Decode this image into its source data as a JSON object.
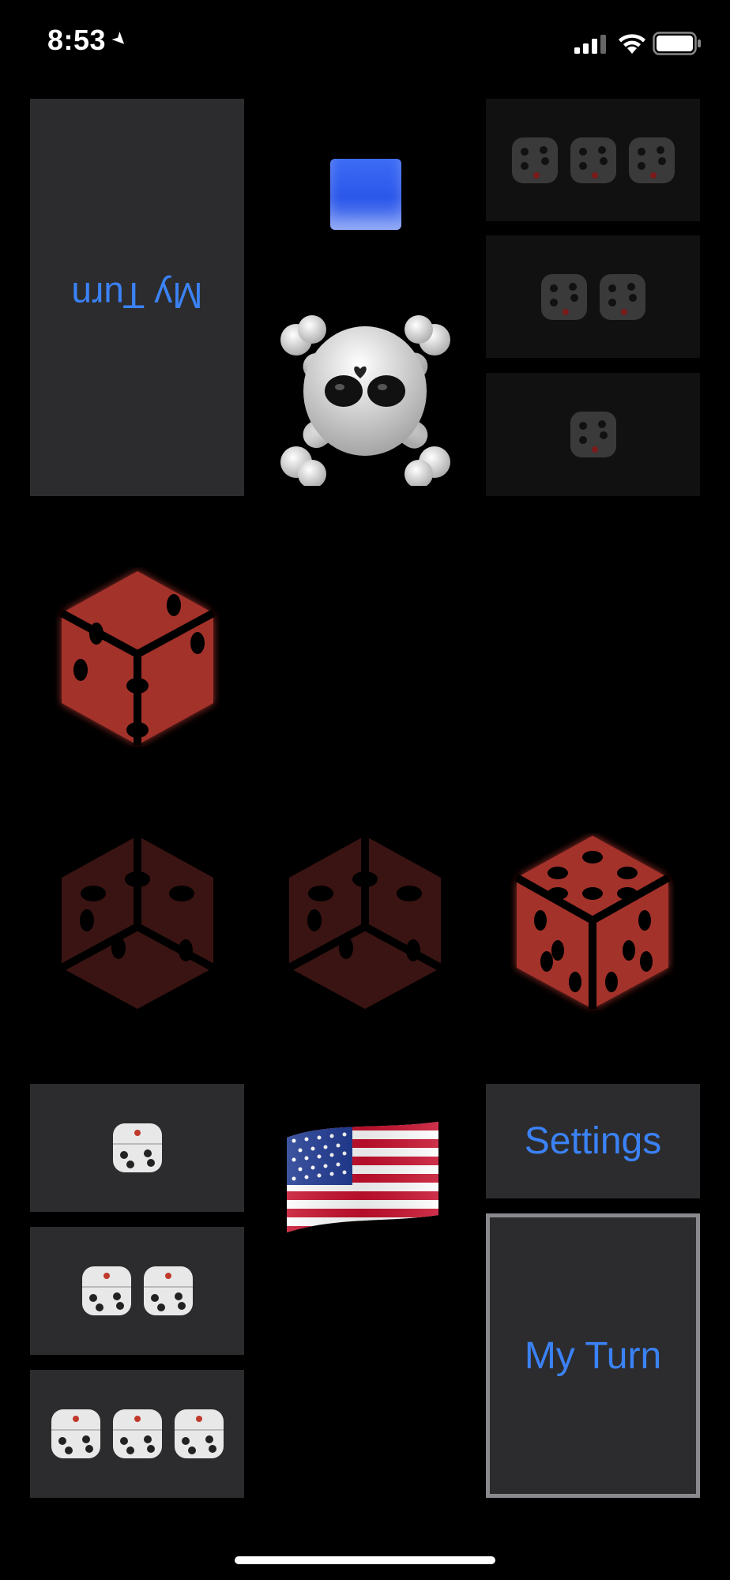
{
  "status_bar": {
    "time": "8:53",
    "location_icon": "location-arrow-icon",
    "signal_icon": "cellular-signal-icon",
    "wifi_icon": "wifi-icon",
    "battery_icon": "battery-icon"
  },
  "top_player": {
    "my_turn_label": "My Turn",
    "rotated": true,
    "bet_options": [
      {
        "dice_count": 3
      },
      {
        "dice_count": 2
      },
      {
        "dice_count": 1
      }
    ],
    "color_indicator": "#2f5ff0",
    "avatar_icon": "skull-crossbones-icon"
  },
  "board": {
    "top_die_icon": "red-die-icon",
    "dice": [
      {
        "state": "dimmed"
      },
      {
        "state": "dimmed"
      },
      {
        "state": "active"
      }
    ],
    "die_color": "#a3302b"
  },
  "bottom_player": {
    "bet_options": [
      {
        "dice_count": 1
      },
      {
        "dice_count": 2
      },
      {
        "dice_count": 3
      }
    ],
    "flag_icon": "us-flag-icon",
    "settings_label": "Settings",
    "my_turn_label": "My Turn"
  },
  "colors": {
    "accent": "#3b82f6",
    "tile": "#2c2c2e",
    "tile_dark": "#111111",
    "background": "#000000"
  }
}
